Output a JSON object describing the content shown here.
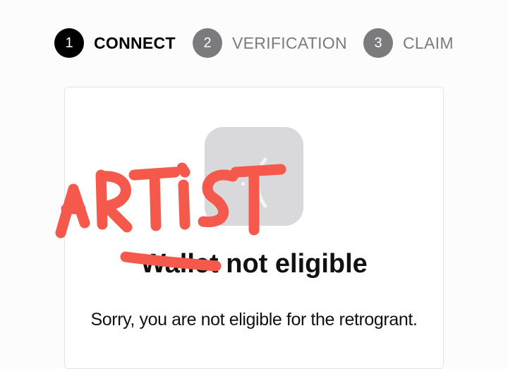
{
  "stepper": {
    "steps": [
      {
        "number": "1",
        "label": "CONNECT",
        "active": true
      },
      {
        "number": "2",
        "label": "VERIFICATION",
        "active": false
      },
      {
        "number": "3",
        "label": "CLAIM",
        "active": false
      }
    ]
  },
  "card": {
    "title_word": "Wallet",
    "title_rest": "not eligible",
    "message": "Sorry, you are not eligible for the retrogrant.",
    "icon": "sad-face-icon"
  },
  "annotation": {
    "text": "ARTIST",
    "color": "#f4594b"
  },
  "colors": {
    "active_step": "#000000",
    "inactive_step": "#7b7b7e",
    "icon_tile": "#d9d9db"
  }
}
